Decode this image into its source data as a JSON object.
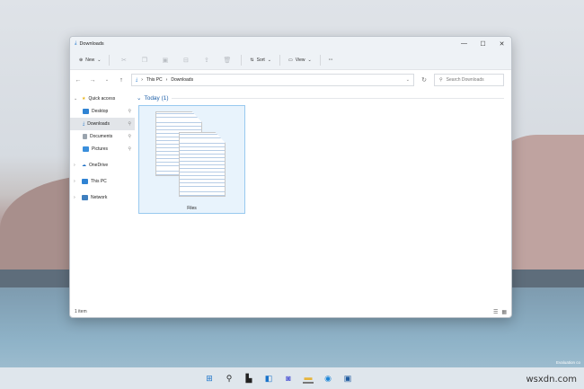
{
  "window": {
    "title": "Downloads",
    "minimize": "—",
    "maximize": "☐",
    "close": "✕"
  },
  "toolbar": {
    "new_label": "New",
    "sort_label": "Sort",
    "view_label": "View",
    "more": "···"
  },
  "address": {
    "path": [
      "This PC",
      "Downloads"
    ],
    "search_placeholder": "Search Downloads"
  },
  "sidebar": {
    "items": [
      {
        "label": "Quick access"
      },
      {
        "label": "Desktop"
      },
      {
        "label": "Downloads"
      },
      {
        "label": "Documents"
      },
      {
        "label": "Pictures"
      },
      {
        "label": "OneDrive"
      },
      {
        "label": "This PC"
      },
      {
        "label": "Network"
      }
    ]
  },
  "main": {
    "group_label": "Today (1)",
    "file_label": "Files"
  },
  "status": {
    "count": "1 item"
  },
  "desktop": {
    "evaluation_text": "Evaluation co",
    "watermark": "wsxdn.com"
  }
}
